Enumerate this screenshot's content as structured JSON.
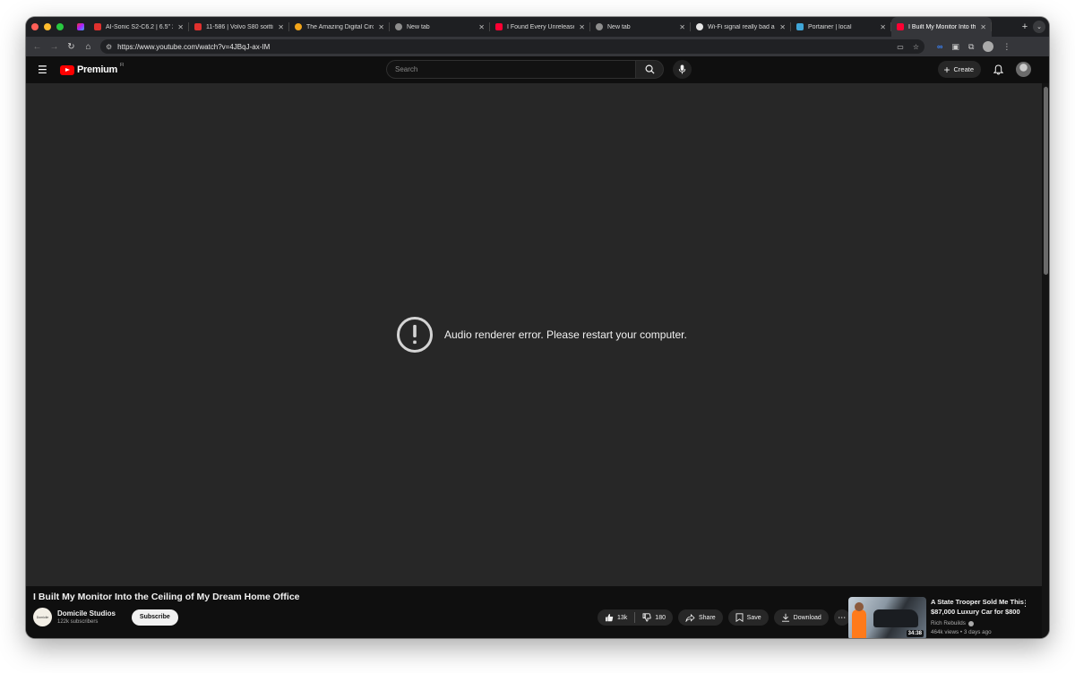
{
  "browser": {
    "tabs": [
      {
        "title": "AI-Sonic S2-C6.2 | 6.5\" 2",
        "favicon": "red"
      },
      {
        "title": "11-586 | Volvo S80 soittim",
        "favicon": "red"
      },
      {
        "title": "The Amazing Digital Circu",
        "favicon": "orange"
      },
      {
        "title": "New tab",
        "favicon": "gray"
      },
      {
        "title": "I Found Every Unreleased",
        "favicon": "yt"
      },
      {
        "title": "New tab",
        "favicon": "gray"
      },
      {
        "title": "Wi-Fi signal really bad an",
        "favicon": "gh"
      },
      {
        "title": "Portainer | local",
        "favicon": "port"
      },
      {
        "title": "I Built My Monitor Into the",
        "favicon": "yt",
        "active": true
      }
    ],
    "url": "https://www.youtube.com/watch?v=4JBqJ-ax-IM"
  },
  "yt": {
    "logo_text": "Premium",
    "logo_cc": "FI",
    "search_placeholder": "Search",
    "create_label": "Create"
  },
  "player": {
    "error_message": "Audio renderer error. Please restart your computer."
  },
  "video": {
    "title": "I Built My Monitor Into the Ceiling of My Dream Home Office",
    "channel_name": "Domicile Studios",
    "channel_avatar_text": "Domicile",
    "subscribers": "122k subscribers",
    "subscribe_label": "Subscribe",
    "likes": "13k",
    "dislikes": "180",
    "share_label": "Share",
    "save_label": "Save",
    "download_label": "Download"
  },
  "recommendation": {
    "title": "A State Trooper Sold Me This $87,000 Luxury Car for $800",
    "channel": "Rich Rebuilds",
    "meta": "464k views • 3 days ago",
    "duration": "34:38"
  },
  "colors": {
    "player_bg": "#272727",
    "page_bg": "#0f0f0f",
    "brand_red": "#ff0000"
  }
}
